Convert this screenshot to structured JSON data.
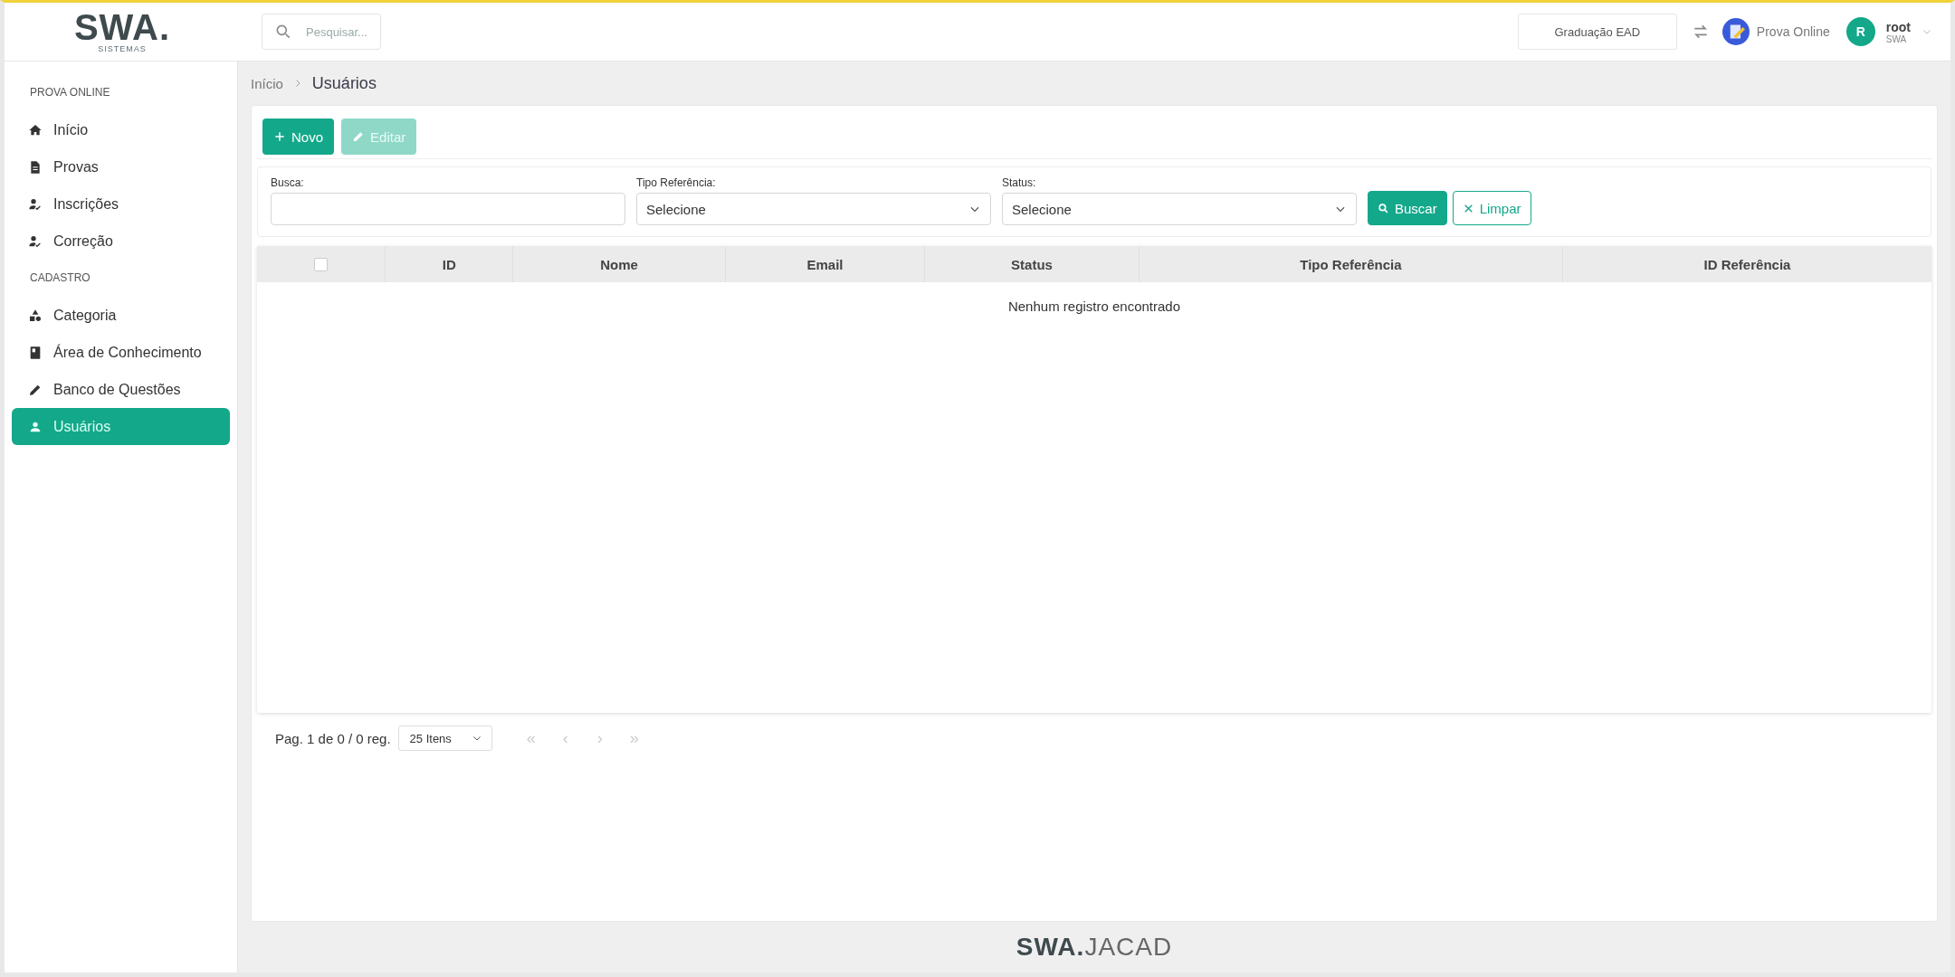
{
  "header": {
    "logo": "SWA.",
    "logo_subtitle": "SISTEMAS",
    "search": {
      "placeholder": "Pesquisar..."
    },
    "context": "Graduação EAD",
    "module": "Prova Online",
    "user": {
      "initial": "R",
      "name": "root",
      "org": "SWA"
    }
  },
  "sidebar": {
    "groups": [
      {
        "title": "PROVA ONLINE",
        "items": [
          {
            "label": "Início",
            "selected": false
          },
          {
            "label": "Provas",
            "selected": false
          },
          {
            "label": "Inscrições",
            "selected": false
          },
          {
            "label": "Correção",
            "selected": false
          }
        ]
      },
      {
        "title": "CADASTRO",
        "items": [
          {
            "label": "Categoria",
            "selected": false
          },
          {
            "label": "Área de Conhecimento",
            "selected": false
          },
          {
            "label": "Banco de Questões",
            "selected": false
          },
          {
            "label": "Usuários",
            "selected": true
          }
        ]
      }
    ]
  },
  "breadcrumb": [
    "Início",
    "Usuários"
  ],
  "toolbar": [
    {
      "label": "Novo",
      "disabled": false
    },
    {
      "label": "Editar",
      "disabled": true
    }
  ],
  "filters": [
    {
      "kind": "text",
      "label": "Busca:"
    },
    {
      "kind": "select",
      "label": "Tipo Referência:",
      "value": "Selecione"
    },
    {
      "kind": "select",
      "label": "Status:",
      "value": "Selecione"
    }
  ],
  "filter_actions": [
    {
      "kind": "primary",
      "label": "Buscar"
    },
    {
      "kind": "outline",
      "label": "Limpar"
    }
  ],
  "table": {
    "select_all": {
      "checked": false
    },
    "columns": [
      "ID",
      "Nome",
      "Email",
      "Status",
      "Tipo Referência",
      "ID Referência"
    ],
    "empty_message": "Nenhum registro encontrado"
  },
  "pagination": {
    "summary": "Pag. 1 de 0 / 0 reg.",
    "page_size": "25 Itens",
    "nav": [
      {
        "symbol": "«",
        "disabled": true
      },
      {
        "symbol": "‹",
        "disabled": true
      },
      {
        "symbol": "›",
        "disabled": true
      },
      {
        "symbol": "»",
        "disabled": true
      }
    ]
  },
  "footer": "**SWA.**JACAD"
}
